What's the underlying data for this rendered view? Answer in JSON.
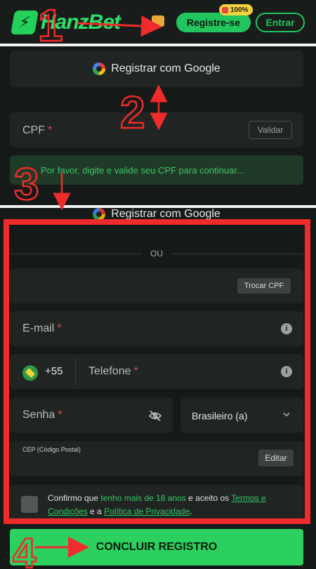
{
  "header": {
    "logo_text": "HanzBet",
    "register_label": "Registre-se",
    "register_badge": "100%",
    "login_label": "Entrar"
  },
  "section_cpf": {
    "google_label": "Registrar com Google",
    "cpf_label": "CPF",
    "required_mark": "*",
    "validate_label": "Validar",
    "info_message": "Por favor, digite e valide seu CPF para continuar..."
  },
  "section_form": {
    "google_label": "Registrar com Google",
    "divider_text": "OU",
    "swap_cpf_label": "Trocar CPF",
    "email_label": "E-mail",
    "country_code": "+55",
    "phone_label": "Telefone",
    "password_label": "Senha",
    "language_value": "Brasileiro (a)",
    "cep_label": "CEP (Código Postal)",
    "edit_label": "Editar",
    "terms": {
      "part1": "Confirmo que ",
      "highlight": "tenho mais de 18 anos",
      "part2": " e aceito os ",
      "terms_link": "Termos e Condições",
      "part3": " e a ",
      "privacy_link": "Política de Privacidade",
      "part4": "."
    },
    "submit_label": "CONCLUIR REGISTRO"
  },
  "annotations": {
    "step1": "1",
    "step2": "2",
    "step3": "3",
    "step4": "4"
  },
  "colors": {
    "accent": "#22c55e",
    "annotation_red": "#ef2b2b",
    "background": "#151917",
    "card": "#202523"
  }
}
